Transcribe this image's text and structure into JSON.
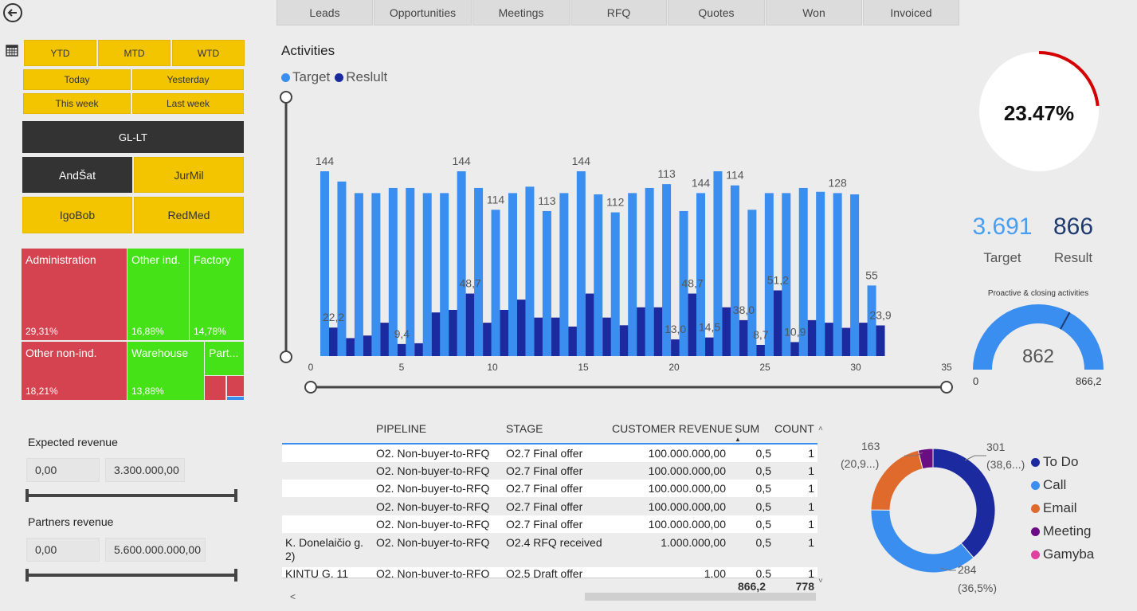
{
  "nav": {
    "tabs": [
      "Leads",
      "Opportunities",
      "Meetings",
      "RFQ",
      "Quotes",
      "Won",
      "Invoiced"
    ]
  },
  "filters": {
    "period_row1": [
      "YTD",
      "MTD",
      "WTD"
    ],
    "period_row2": [
      "Today",
      "Yesterday"
    ],
    "period_row3": [
      "This week",
      "Last week"
    ],
    "team": "GL-LT",
    "people": [
      "AndŠat",
      "JurMil",
      "IgoBob",
      "RedMed"
    ]
  },
  "treemap": {
    "items": [
      {
        "label": "Administration",
        "pct": "29,31%"
      },
      {
        "label": "Other ind.",
        "pct": "16,88%"
      },
      {
        "label": "Factory",
        "pct": "14,78%"
      },
      {
        "label": "Other non-ind.",
        "pct": "18,21%"
      },
      {
        "label": "Warehouse",
        "pct": "13,88%"
      },
      {
        "label": "Part...",
        "pct": ""
      }
    ]
  },
  "expected_revenue": {
    "label": "Expected revenue",
    "min": "0,00",
    "max": "3.300.000,00"
  },
  "partners_revenue": {
    "label": "Partners revenue",
    "min": "0,00",
    "max": "5.600.000.000,00"
  },
  "activities": {
    "title": "Activities",
    "legend": [
      {
        "name": "Target",
        "color": "#3a8ef0"
      },
      {
        "name": "Reslult",
        "color": "#1c2aa0"
      }
    ]
  },
  "chart_data": {
    "type": "bar",
    "title": "Activities",
    "x": [
      1,
      2,
      3,
      4,
      5,
      6,
      7,
      8,
      9,
      10,
      11,
      12,
      13,
      14,
      15,
      16,
      17,
      18,
      19,
      20,
      21,
      22,
      23,
      24,
      25,
      26,
      27,
      28,
      29,
      30,
      31
    ],
    "xlim": [
      0,
      35
    ],
    "xticks": [
      0,
      5,
      10,
      15,
      20,
      25,
      30,
      35
    ],
    "series": [
      {
        "name": "Target",
        "color": "#3a8ef0",
        "values": [
          144,
          136,
          127,
          127,
          131,
          131,
          127,
          127,
          144,
          131,
          114,
          127,
          132,
          113,
          127,
          144,
          126,
          112,
          127,
          131,
          134,
          113,
          127,
          144,
          133,
          114,
          127,
          127,
          131,
          128,
          127,
          126,
          55
        ]
      },
      {
        "name": "Reslult",
        "color": "#1c2aa0",
        "values": [
          22.2,
          14,
          16,
          26,
          9.4,
          10,
          34,
          36,
          48.7,
          26,
          36,
          44,
          30,
          30,
          23,
          48.7,
          30,
          24,
          38,
          38,
          13,
          48.7,
          14.5,
          38,
          28,
          8.7,
          51.2,
          10.9,
          28,
          26,
          22,
          26,
          23.9
        ]
      }
    ],
    "labels": [
      {
        "i": 0,
        "s": 0,
        "text": "144"
      },
      {
        "i": 0,
        "s": 1,
        "text": "22,2"
      },
      {
        "i": 4,
        "s": 1,
        "text": "9,4"
      },
      {
        "i": 8,
        "s": 0,
        "text": "144"
      },
      {
        "i": 8,
        "s": 1,
        "text": "48,7"
      },
      {
        "i": 10,
        "s": 0,
        "text": "114"
      },
      {
        "i": 13,
        "s": 0,
        "text": "113"
      },
      {
        "i": 15,
        "s": 0,
        "text": "144"
      },
      {
        "i": 17,
        "s": 0,
        "text": "112"
      },
      {
        "i": 20,
        "s": 0,
        "text": "113"
      },
      {
        "i": 20,
        "s": 1,
        "text": "13,0"
      },
      {
        "i": 21,
        "s": 1,
        "text": "48,7"
      },
      {
        "i": 22,
        "s": 0,
        "text": "144"
      },
      {
        "i": 22,
        "s": 1,
        "text": "14,5"
      },
      {
        "i": 24,
        "s": 0,
        "text": "114"
      },
      {
        "i": 24,
        "s": 1,
        "text": "38,0"
      },
      {
        "i": 25,
        "s": 1,
        "text": "8,7"
      },
      {
        "i": 26,
        "s": 1,
        "text": "51,2"
      },
      {
        "i": 27,
        "s": 1,
        "text": "10,9"
      },
      {
        "i": 30,
        "s": 0,
        "text": "128"
      },
      {
        "i": 32,
        "s": 0,
        "text": "55"
      },
      {
        "i": 32,
        "s": 1,
        "text": "23,9"
      }
    ],
    "ylim": [
      0,
      160
    ]
  },
  "kpi": {
    "percent": "23.47%",
    "percent_value": 0.2347,
    "target_value": "3.691",
    "target_label": "Target",
    "result_value": "866",
    "result_label": "Result"
  },
  "gauge": {
    "title": "Proactive & closing activities",
    "value": "862",
    "min": "0",
    "max": "866,2",
    "fill_fraction": 1.0,
    "target_fraction": 0.66
  },
  "table": {
    "columns": [
      "PIPELINE",
      "STAGE",
      "CUSTOMER REVENUE",
      "SUM",
      "COUNT"
    ],
    "rows": [
      {
        "c0": "",
        "pipeline": "O2. Non-buyer-to-RFQ",
        "stage": "O2.7 Final offer",
        "revenue": "100.000.000,00",
        "sum": "0,5",
        "count": "1"
      },
      {
        "c0": "",
        "pipeline": "O2. Non-buyer-to-RFQ",
        "stage": "O2.7 Final offer",
        "revenue": "100.000.000,00",
        "sum": "0,5",
        "count": "1"
      },
      {
        "c0": "",
        "pipeline": "O2. Non-buyer-to-RFQ",
        "stage": "O2.7 Final offer",
        "revenue": "100.000.000,00",
        "sum": "0,5",
        "count": "1"
      },
      {
        "c0": "",
        "pipeline": "O2. Non-buyer-to-RFQ",
        "stage": "O2.7 Final offer",
        "revenue": "100.000.000,00",
        "sum": "0,5",
        "count": "1"
      },
      {
        "c0": "",
        "pipeline": "O2. Non-buyer-to-RFQ",
        "stage": "O2.7 Final offer",
        "revenue": "100.000.000,00",
        "sum": "0,5",
        "count": "1"
      },
      {
        "c0": "K. Donelaičio g.",
        "c0b": "2)",
        "pipeline": "O2. Non-buyer-to-RFQ",
        "stage": "O2.4 RFQ received",
        "revenue": "1.000.000,00",
        "sum": "0,5",
        "count": "1"
      },
      {
        "c0": "KINTU G. 11",
        "pipeline": "O2. Non-buyer-to-RFQ",
        "stage": "O2.5 Draft offer",
        "revenue": "1,00",
        "sum": "0,5",
        "count": "1"
      }
    ],
    "totals": {
      "sum": "866,2",
      "count": "778"
    }
  },
  "donut": {
    "labels": [
      {
        "value": "163",
        "pct": "(20,9...)"
      },
      {
        "value": "301",
        "pct": "(38,6...)"
      },
      {
        "value": "284",
        "pct": "(36,5%)"
      }
    ],
    "legend": [
      {
        "name": "To Do",
        "color": "#1c2aa0"
      },
      {
        "name": "Call",
        "color": "#3a8ef0"
      },
      {
        "name": "Email",
        "color": "#e0692c"
      },
      {
        "name": "Meeting",
        "color": "#6a0d83"
      },
      {
        "name": "Gamyba",
        "color": "#e040a0"
      }
    ],
    "slices": [
      {
        "name": "To Do",
        "value": 301
      },
      {
        "name": "Call",
        "value": 284
      },
      {
        "name": "Email",
        "value": 163
      },
      {
        "name": "Meeting",
        "value": 30
      }
    ]
  }
}
